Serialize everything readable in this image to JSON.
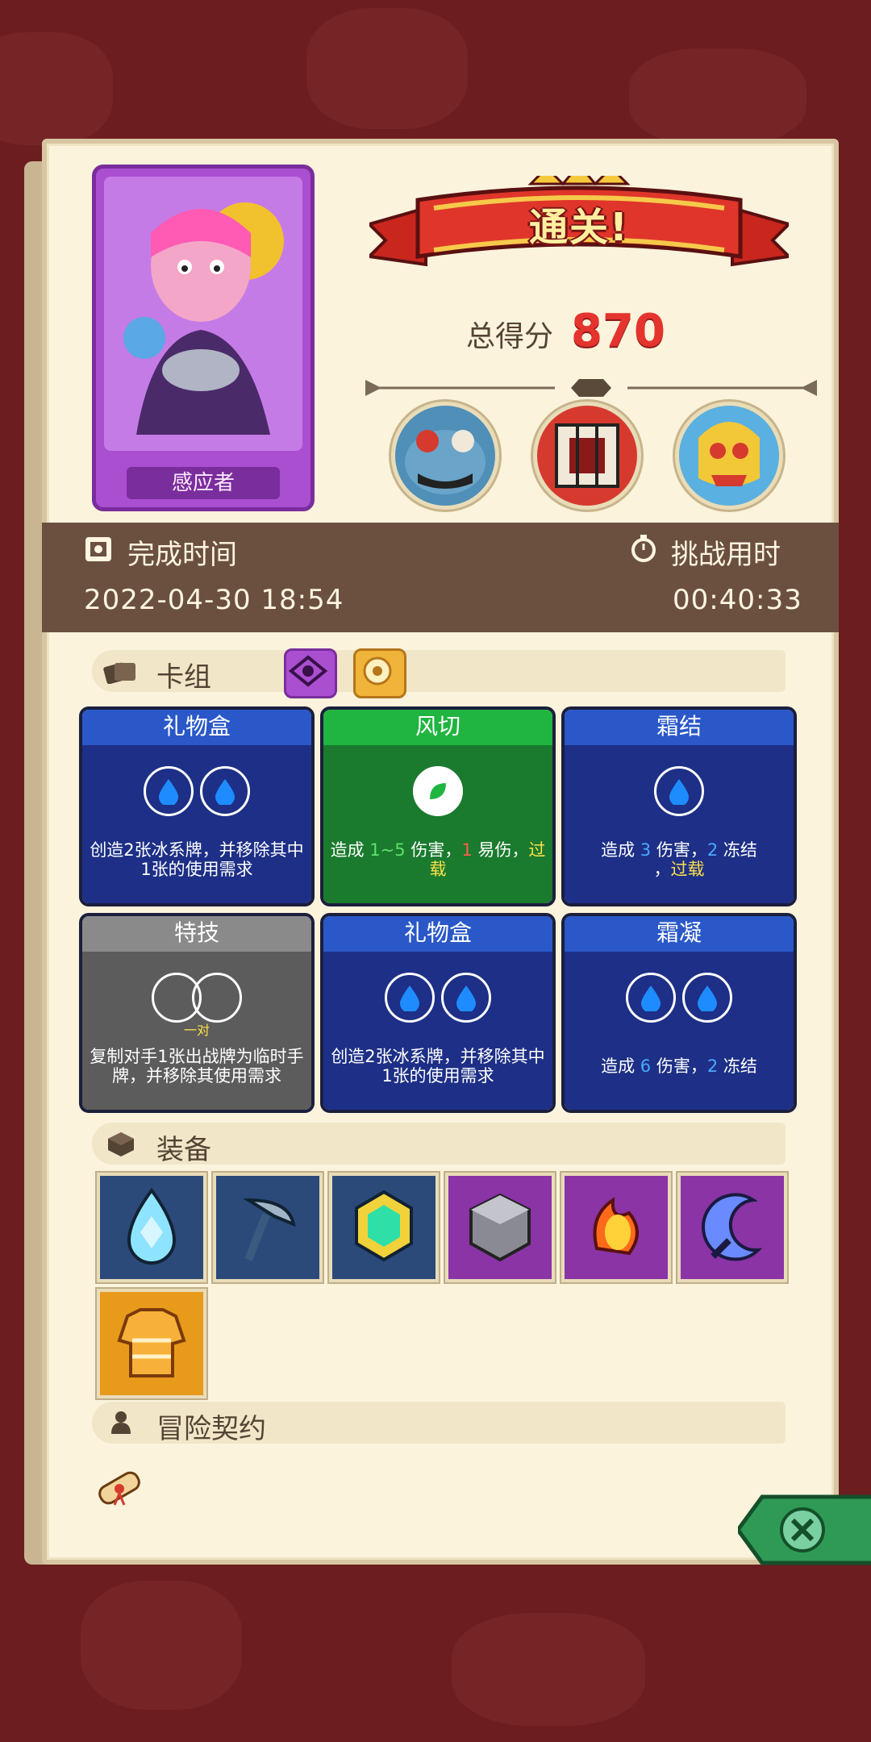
{
  "character": {
    "name": "感应者",
    "colors": {
      "frame": "#a94fd0"
    }
  },
  "result": {
    "banner_text": "通关!",
    "score_label": "总得分",
    "score_value": "870"
  },
  "bosses": [
    {
      "name": "boss-frog",
      "icon": "frog-monster-icon"
    },
    {
      "name": "boss-cage",
      "icon": "caged-demon-icon"
    },
    {
      "name": "boss-skull",
      "icon": "skull-monster-icon"
    }
  ],
  "time": {
    "complete_label": "完成时间",
    "complete_value": "2022-04-30 18:54",
    "challenge_label": "挑战用时",
    "challenge_value": "00:40:33"
  },
  "deck": {
    "title": "卡组",
    "cards": [
      {
        "name": "礼物盒",
        "type": "water",
        "circles": 2,
        "desc": "创造2张冰系牌，并移除其中1张的使用需求"
      },
      {
        "name": "风切",
        "type": "wind",
        "circles": 1,
        "desc_parts": [
          "造成 ",
          "1~5",
          " 伤害，",
          "1",
          " 易伤，",
          "过载"
        ]
      },
      {
        "name": "霜结",
        "type": "water",
        "circles": 1,
        "desc_parts": [
          "造成 ",
          "3",
          " 伤害，",
          "2",
          " 冻结",
          "，",
          "过载"
        ]
      },
      {
        "name": "特技",
        "type": "gray",
        "circles": 2,
        "pair_label": "一对",
        "desc": "复制对手1张出战牌为临时手牌，并移除其使用需求"
      },
      {
        "name": "礼物盒",
        "type": "water",
        "circles": 2,
        "desc": "创造2张冰系牌，并移除其中1张的使用需求"
      },
      {
        "name": "霜凝",
        "type": "water",
        "circles": 2,
        "desc_parts": [
          "造成 ",
          "6",
          " 伤害，",
          "2",
          " 冻结"
        ]
      }
    ]
  },
  "equipment": {
    "title": "装备",
    "items": [
      {
        "icon": "ice-crystal-icon",
        "bg": "#2b4a7a"
      },
      {
        "icon": "ice-pickaxe-icon",
        "bg": "#2b4a7a"
      },
      {
        "icon": "emerald-gem-icon",
        "bg": "#2b4a7a"
      },
      {
        "icon": "stone-cube-icon",
        "bg": "#8a34a6"
      },
      {
        "icon": "fire-amulet-icon",
        "bg": "#8a34a6"
      },
      {
        "icon": "crescent-blade-icon",
        "bg": "#8a34a6"
      },
      {
        "icon": "orange-sweater-icon",
        "bg": "#e89a1a"
      }
    ]
  },
  "contract": {
    "title": "冒险契约",
    "icon": "scroll-icon"
  },
  "colors": {
    "water": "#1d2f86",
    "water_head": "#2a58c8",
    "wind": "#1a7a2e",
    "wind_head": "#20b540",
    "gray": "#5c5c5c",
    "gray_head": "#8a8a8a"
  }
}
